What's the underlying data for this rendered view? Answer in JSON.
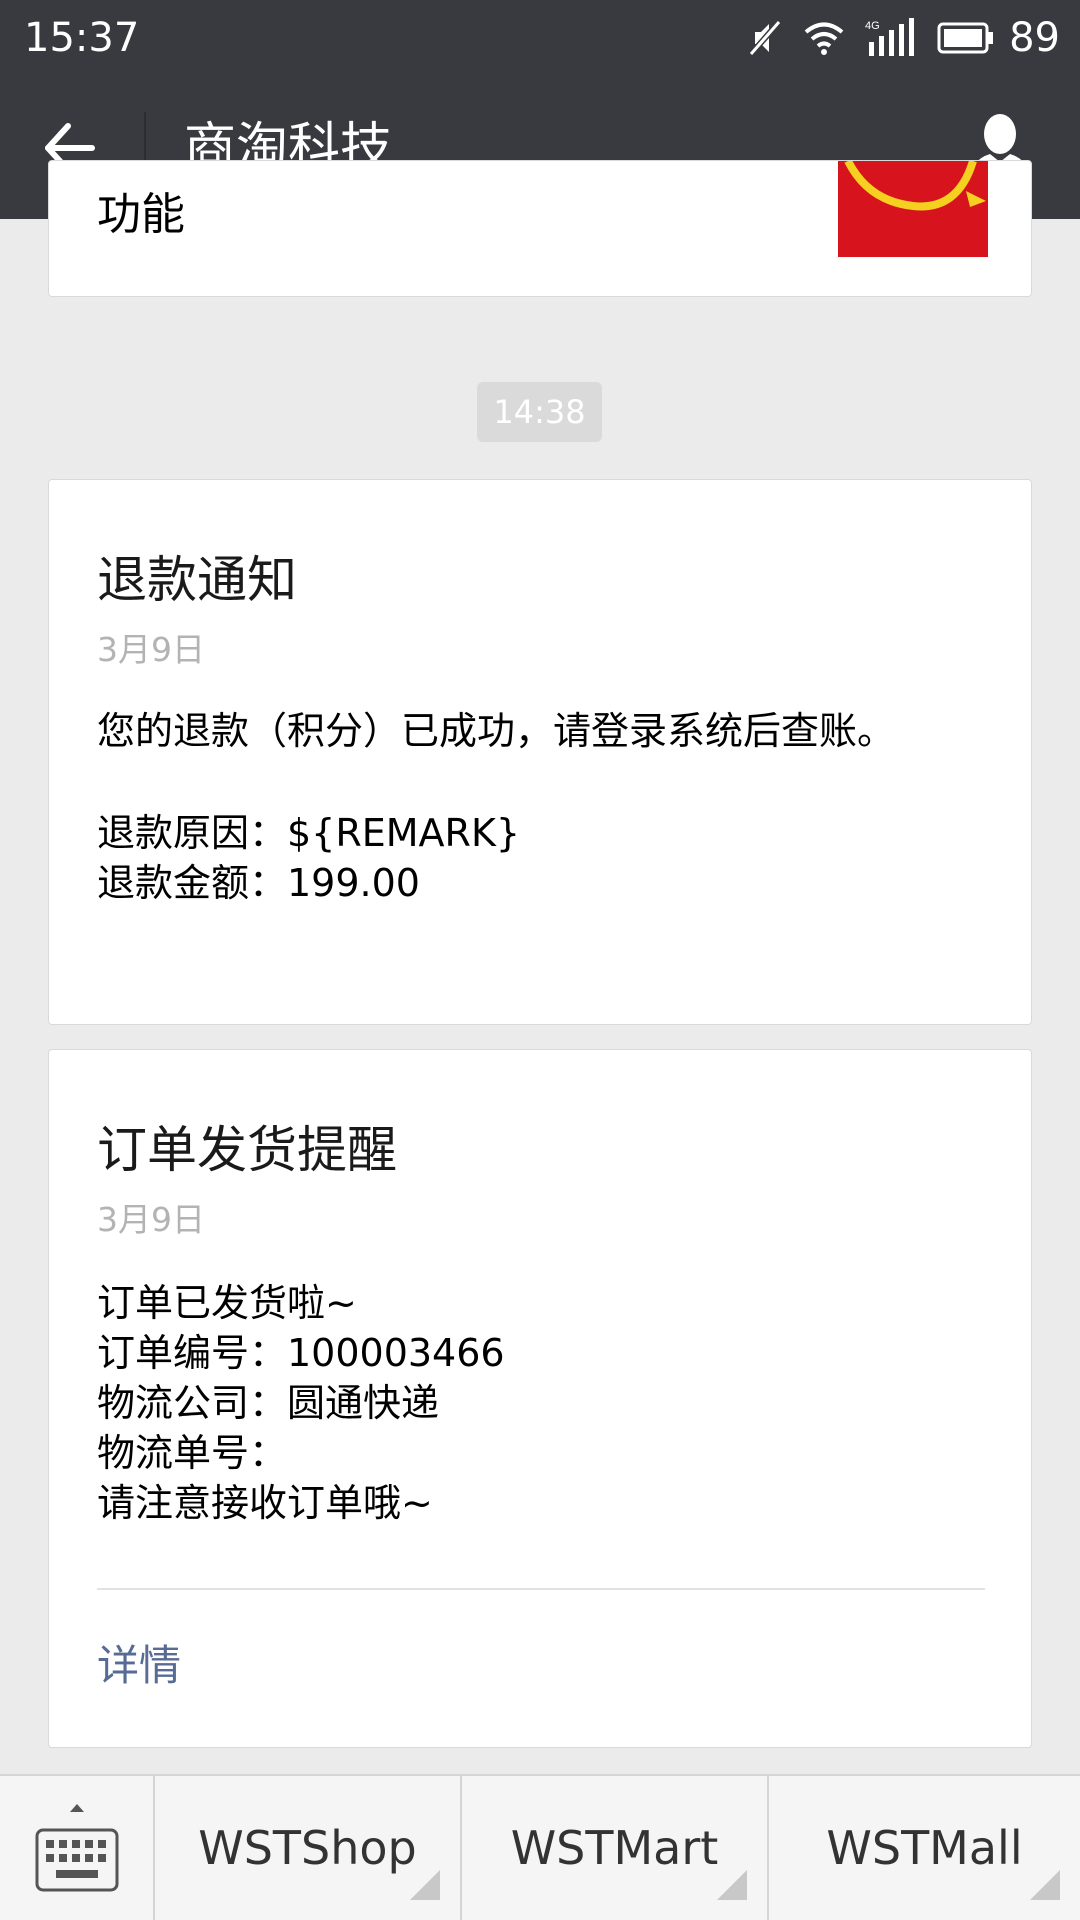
{
  "status_bar": {
    "time": "15:37",
    "network": "4G",
    "battery": "89",
    "icons": [
      "mute-icon",
      "wifi-icon",
      "signal-icon",
      "battery-icon"
    ]
  },
  "header": {
    "title": "商淘科技",
    "back_icon": "arrow-left-icon",
    "profile_icon": "person-icon"
  },
  "previous_message": {
    "text": "功能"
  },
  "timestamp": "14:38",
  "refund_card": {
    "title": "退款通知",
    "date": "3月9日",
    "body": "您的退款（积分）已成功，请登录系统后查账。",
    "reason": "退款原因：${REMARK}",
    "amount": "退款金额：199.00"
  },
  "shipping_card": {
    "title": "订单发货提醒",
    "date": "3月9日",
    "lines": [
      "订单已发货啦~",
      "订单编号：100003466",
      "物流公司：圆通快递",
      "物流单号：",
      "请注意接收订单哦~"
    ],
    "details_label": "详情"
  },
  "bottom_menu": {
    "keyboard_icon": "keyboard-icon",
    "items": [
      "WSTShop",
      "WSTMart",
      "WSTMall"
    ]
  },
  "colors": {
    "bar": "#393a3f",
    "background": "#ebebeb",
    "link": "#576b95",
    "thumb": "#d7141d"
  }
}
